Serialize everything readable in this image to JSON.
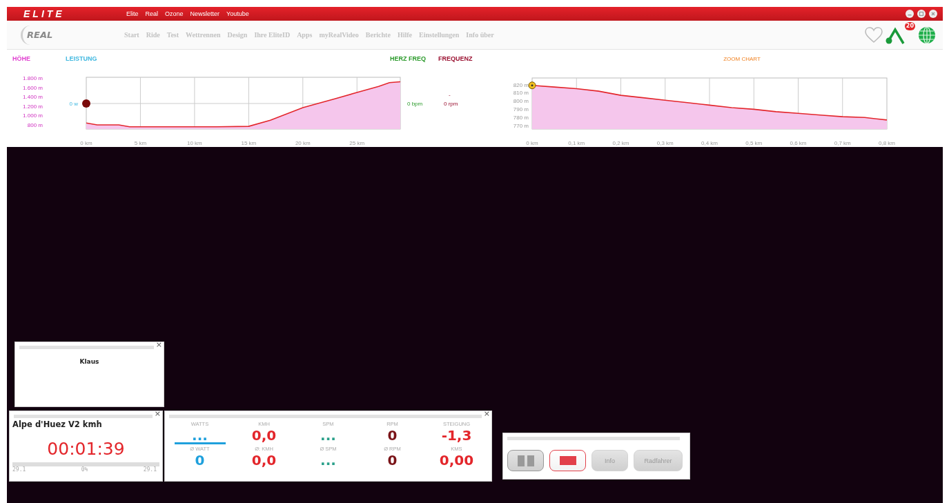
{
  "window": {
    "logo": "ELITE",
    "menu": [
      "Elite",
      "Real",
      "Ozone",
      "Newsletter",
      "Youtube"
    ]
  },
  "nav": {
    "logo": "REAL",
    "items": [
      "Start",
      "Ride",
      "Test",
      "Wettrennen",
      "Design",
      "Ihre EliteID",
      "Apps",
      "myRealVideo",
      "Berichte",
      "Hilfe",
      "Einstellungen",
      "Info über"
    ],
    "badge": "20"
  },
  "elevation_chart": {
    "labels": [
      {
        "text": "HÖHE",
        "color": "#e040d0"
      },
      {
        "text": "LEISTUNG",
        "color": "#40b8e0"
      },
      {
        "text": "HERZ FREQ",
        "color": "#2a9a2a"
      },
      {
        "text": "FREQUENZ",
        "color": "#9a1030"
      }
    ],
    "power": "0 w",
    "heart_rate": "0 bpm",
    "cadence_mark": "-",
    "cadence": "0 rpm",
    "chart_data": {
      "type": "area",
      "x": [
        0,
        1,
        3,
        4,
        5,
        8,
        10,
        12,
        15,
        17,
        20,
        23,
        25,
        27,
        28,
        29
      ],
      "series": [
        {
          "color": "#e3262b",
          "values": [
            840,
            800,
            800,
            760,
            760,
            760,
            760,
            760,
            770,
            900,
            1170,
            1360,
            1490,
            1620,
            1700,
            1720
          ]
        }
      ],
      "grid": true,
      "xlim": [
        0,
        29
      ],
      "ylim": [
        712,
        1815
      ],
      "xticks": [
        {
          "value": 0,
          "label": "0 km"
        },
        {
          "value": 5,
          "label": "5 km"
        },
        {
          "value": 10,
          "label": "10 km"
        },
        {
          "value": 15,
          "label": "15 km"
        },
        {
          "value": 20,
          "label": "20 km"
        },
        {
          "value": 25,
          "label": "25 km"
        }
      ],
      "yticks": [
        {
          "value": 1800,
          "label": "1.800 m"
        },
        {
          "value": 1600,
          "label": "1.600 m"
        },
        {
          "value": 1400,
          "label": "1.400 m"
        },
        {
          "value": 1200,
          "label": "1.200 m"
        },
        {
          "value": 1000,
          "label": "1.000 m"
        },
        {
          "value": 800,
          "label": "800 m"
        }
      ]
    }
  },
  "zoom_chart": {
    "title": "ZOOM CHART",
    "chart_data": {
      "type": "area",
      "x": [
        0,
        0.05,
        0.1,
        0.15,
        0.2,
        0.25,
        0.3,
        0.35,
        0.4,
        0.45,
        0.5,
        0.55,
        0.6,
        0.65,
        0.7,
        0.75,
        0.8
      ],
      "series": [
        {
          "color": "#e3262b",
          "values": [
            819,
            817,
            815,
            812,
            807,
            804,
            801,
            798,
            795,
            792,
            790,
            787,
            785,
            783,
            781,
            780,
            777
          ]
        }
      ],
      "grid": true,
      "xlim": [
        0,
        0.8
      ],
      "ylim": [
        766,
        828
      ],
      "xticks": [
        {
          "value": 0,
          "label": "0 km"
        },
        {
          "value": 0.1,
          "label": "0,1 km"
        },
        {
          "value": 0.2,
          "label": "0,2 km"
        },
        {
          "value": 0.3,
          "label": "0,3 km"
        },
        {
          "value": 0.4,
          "label": "0,4 km"
        },
        {
          "value": 0.5,
          "label": "0,5 km"
        },
        {
          "value": 0.6,
          "label": "0,6 km"
        },
        {
          "value": 0.7,
          "label": "0,7 km"
        },
        {
          "value": 0.8,
          "label": "0,8 km"
        }
      ],
      "yticks": [
        {
          "value": 820,
          "label": "820 m"
        },
        {
          "value": 810,
          "label": "810 m"
        },
        {
          "value": 800,
          "label": "800 m"
        },
        {
          "value": 790,
          "label": "790 m"
        },
        {
          "value": 780,
          "label": "780 m"
        },
        {
          "value": 770,
          "label": "770 m"
        }
      ]
    }
  },
  "rider_panel": {
    "close": "×",
    "name": "Klaus"
  },
  "timer_panel": {
    "close": "×",
    "title": "Alpe d'Huez V2 kmh",
    "time": "00:01:39",
    "level": 0,
    "start": "29.1",
    "percent": "0%",
    "end": "29.1"
  },
  "stats_panel": {
    "close": "×"
  },
  "stats": [
    {
      "label": "WATTS",
      "value": "...",
      "avg_label": "Ø WATT",
      "avg_value": "0",
      "color": "#1fa0dc",
      "bar": true
    },
    {
      "label": "KMH",
      "value": "0,0",
      "avg_label": "Ø: KMH",
      "avg_value": "0,0",
      "color": "#e3262b",
      "bar": false
    },
    {
      "label": "SPM",
      "value": "...",
      "avg_label": "Ø SPM",
      "avg_value": "...",
      "color": "#2aa08a",
      "bar": false
    },
    {
      "label": "RPM",
      "value": "0",
      "avg_label": "Ø RPM",
      "avg_value": "0",
      "color": "#7a1418",
      "bar": false
    },
    {
      "label": "STEIGUNG",
      "value": "-1,3",
      "avg_label": "KMS",
      "avg_value": "0,00",
      "color": "#e3262b",
      "bar": false
    }
  ],
  "controls": [
    {
      "kind": "pause"
    },
    {
      "kind": "stop"
    },
    {
      "kind": "text",
      "label": "Info"
    },
    {
      "kind": "text",
      "label": "Radfahrer"
    }
  ]
}
